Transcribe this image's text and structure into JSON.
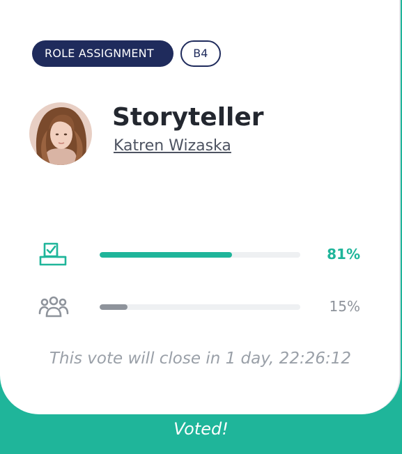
{
  "header": {
    "role_badge": "ROLE ASSIGNMENT",
    "code_badge": "B4"
  },
  "role": {
    "title": "Storyteller",
    "user_name": "Katren Wizaska",
    "avatar_icon": "avatar-photo"
  },
  "stats": [
    {
      "icon": "ballot-box-check-icon",
      "percent_label": "81%",
      "fraction": 0.66,
      "color": "#1fb59a"
    },
    {
      "icon": "people-group-icon",
      "percent_label": "15%",
      "fraction": 0.14,
      "color": "#8e939b"
    }
  ],
  "closing_text": "This vote will close in 1 day, 22:26:12",
  "footer": {
    "status": "Voted!"
  },
  "colors": {
    "accent": "#1fb59a",
    "navy": "#1f2b5c"
  }
}
